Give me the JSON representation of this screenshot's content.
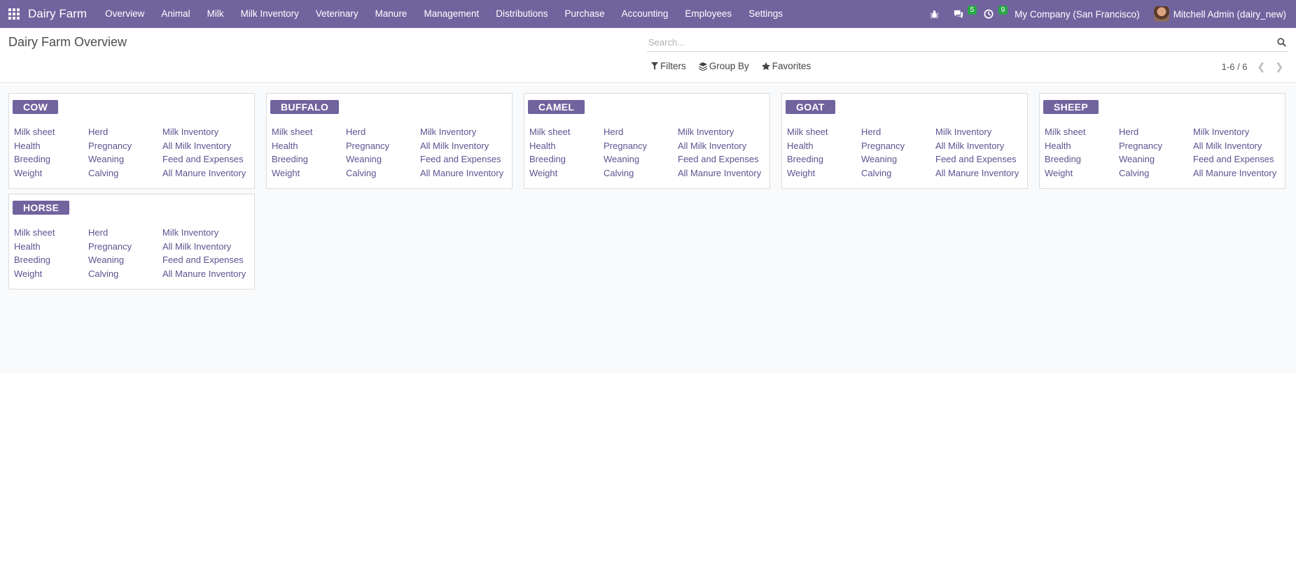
{
  "navbar": {
    "brand": "Dairy Farm",
    "menu": [
      "Overview",
      "Animal",
      "Milk",
      "Milk Inventory",
      "Veterinary",
      "Manure",
      "Management",
      "Distributions",
      "Purchase",
      "Accounting",
      "Employees",
      "Settings"
    ],
    "messages_count": "5",
    "activities_count": "9",
    "company": "My Company (San Francisco)",
    "user": "Mitchell Admin (dairy_new)",
    "colors": {
      "navbar": "#71639e",
      "badge": "#28a745"
    }
  },
  "control_panel": {
    "title": "Dairy Farm Overview",
    "search_placeholder": "Search...",
    "filters_label": "Filters",
    "group_by_label": "Group By",
    "favorites_label": "Favorites",
    "pager": "1-6 / 6"
  },
  "cards": [
    {
      "name": "COW",
      "links": [
        "Milk sheet",
        "Herd",
        "Milk Inventory",
        "Health",
        "Pregnancy",
        "All Milk Inventory",
        "Breeding",
        "Weaning",
        "Feed and Expenses",
        "Weight",
        "Calving",
        "All Manure Inventory"
      ]
    },
    {
      "name": "BUFFALO",
      "links": [
        "Milk sheet",
        "Herd",
        "Milk Inventory",
        "Health",
        "Pregnancy",
        "All Milk Inventory",
        "Breeding",
        "Weaning",
        "Feed and Expenses",
        "Weight",
        "Calving",
        "All Manure Inventory"
      ]
    },
    {
      "name": "CAMEL",
      "links": [
        "Milk sheet",
        "Herd",
        "Milk Inventory",
        "Health",
        "Pregnancy",
        "All Milk Inventory",
        "Breeding",
        "Weaning",
        "Feed and Expenses",
        "Weight",
        "Calving",
        "All Manure Inventory"
      ]
    },
    {
      "name": "GOAT",
      "links": [
        "Milk sheet",
        "Herd",
        "Milk Inventory",
        "Health",
        "Pregnancy",
        "All Milk Inventory",
        "Breeding",
        "Weaning",
        "Feed and Expenses",
        "Weight",
        "Calving",
        "All Manure Inventory"
      ]
    },
    {
      "name": "SHEEP",
      "links": [
        "Milk sheet",
        "Herd",
        "Milk Inventory",
        "Health",
        "Pregnancy",
        "All Milk Inventory",
        "Breeding",
        "Weaning",
        "Feed and Expenses",
        "Weight",
        "Calving",
        "All Manure Inventory"
      ]
    },
    {
      "name": "HORSE",
      "links": [
        "Milk sheet",
        "Herd",
        "Milk Inventory",
        "Health",
        "Pregnancy",
        "All Milk Inventory",
        "Breeding",
        "Weaning",
        "Feed and Expenses",
        "Weight",
        "Calving",
        "All Manure Inventory"
      ]
    }
  ]
}
